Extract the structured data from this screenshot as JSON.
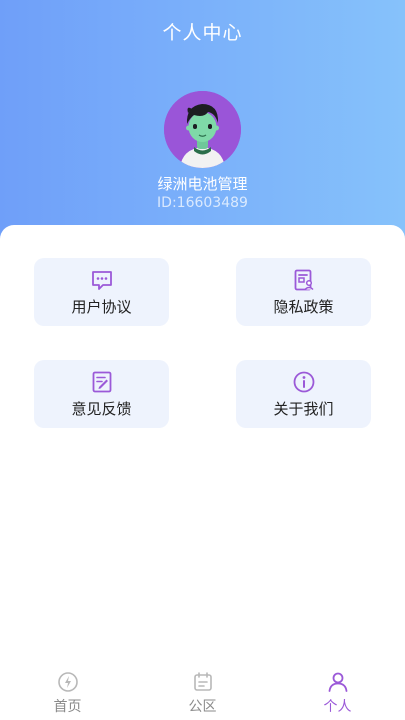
{
  "header": {
    "title": "个人中心"
  },
  "profile": {
    "name": "绿洲电池管理",
    "id_text": "ID:16603489"
  },
  "menu": [
    {
      "label": "用户协议",
      "icon": "chat-message-icon"
    },
    {
      "label": "隐私政策",
      "icon": "privacy-document-icon"
    },
    {
      "label": "意见反馈",
      "icon": "feedback-edit-icon"
    },
    {
      "label": "关于我们",
      "icon": "info-circle-icon"
    }
  ],
  "tabbar": {
    "items": [
      {
        "label": "首页",
        "icon": "lightning-icon",
        "active": false
      },
      {
        "label": "公区",
        "icon": "calendar-icon",
        "active": false
      },
      {
        "label": "个人",
        "icon": "person-icon",
        "active": true
      }
    ]
  },
  "colors": {
    "accent": "#9b59d8",
    "header_gradient_start": "#6f9ff9",
    "header_gradient_end": "#86c2fb",
    "card_background": "#eef3fd",
    "inactive_tab": "#8a8a8a"
  }
}
